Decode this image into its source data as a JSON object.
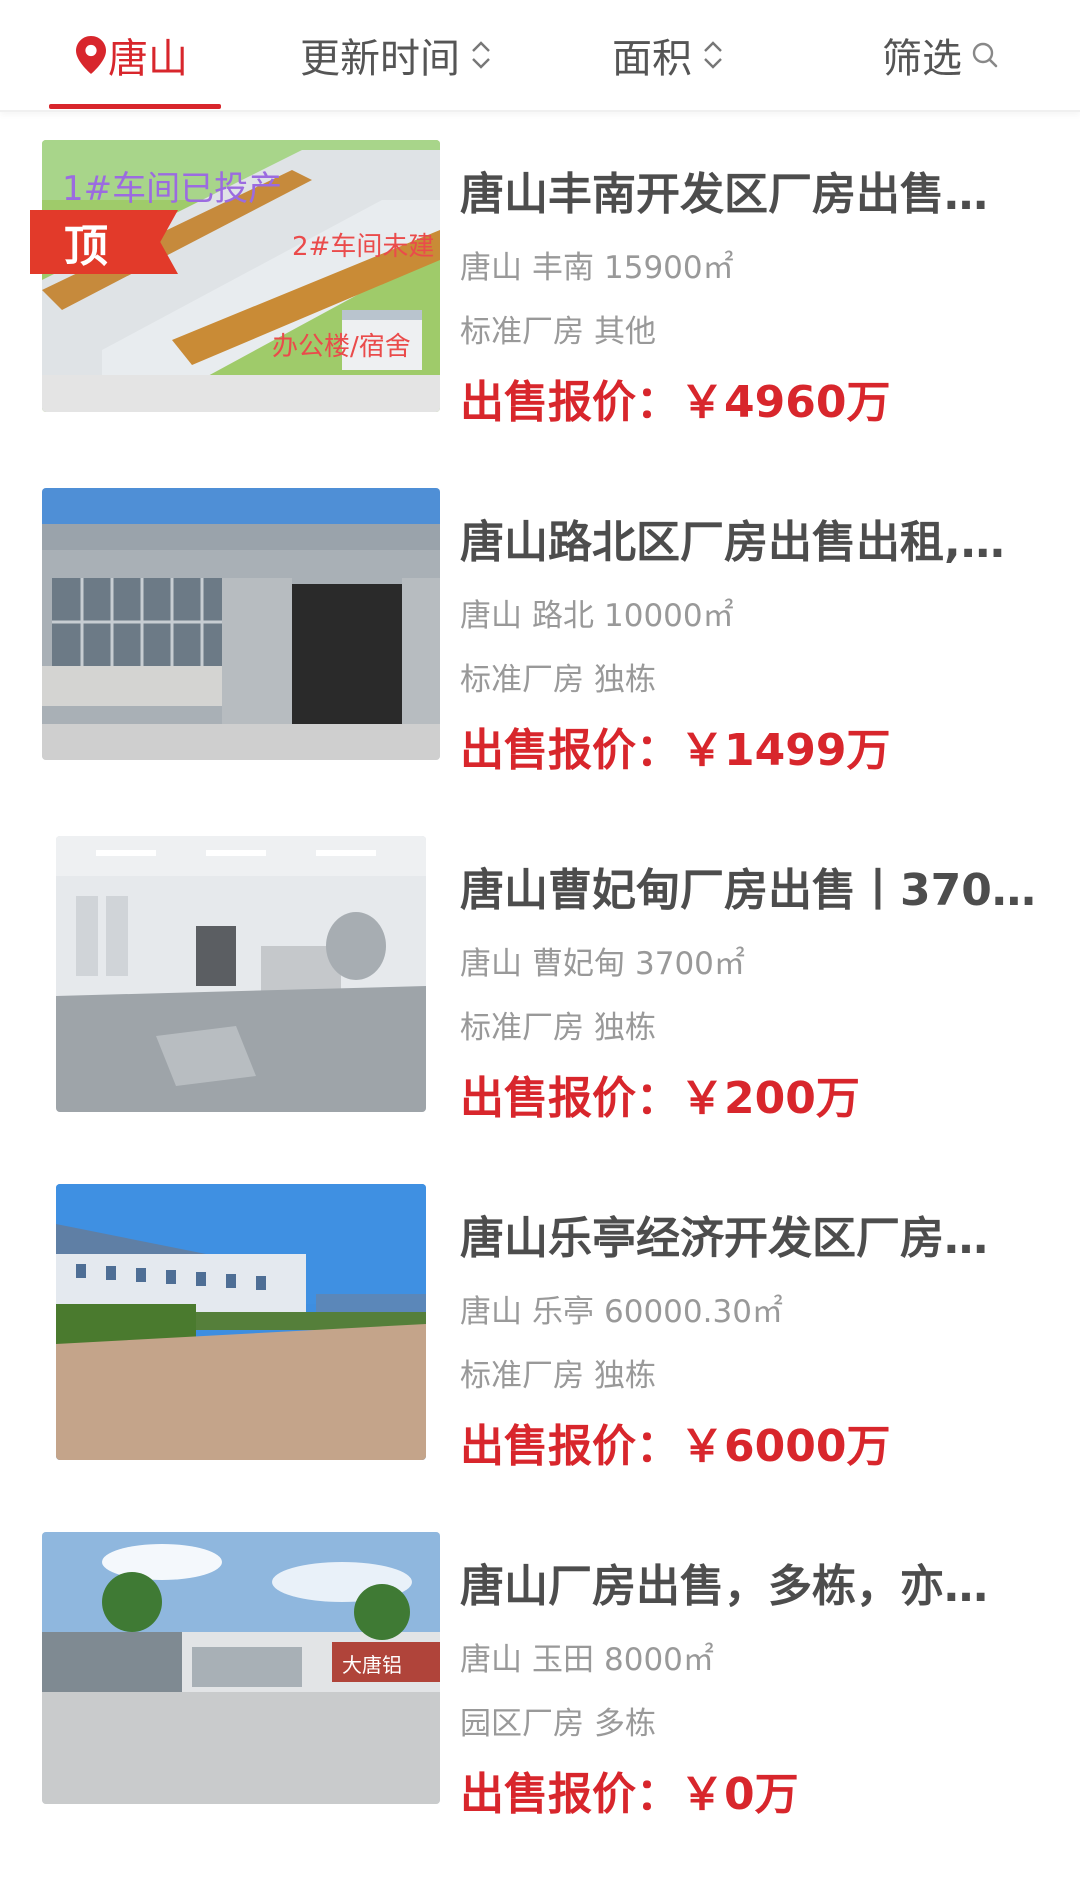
{
  "filter_bar": {
    "city_label": "唐山",
    "update_label": "更新时间",
    "area_label": "面积",
    "filter_label": "筛选",
    "accent_color": "#d8262c"
  },
  "listings": [
    {
      "title": "唐山丰南开发区厂房出售…",
      "city": "唐山",
      "district": "丰南",
      "area": "15900㎡",
      "type": "标准厂房",
      "structure": "其他",
      "price_label": "出售报价：",
      "price": "￥4960万",
      "badge": "顶",
      "image_text_1": "1#车间已投产",
      "image_text_2": "2#车间未建",
      "image_text_3": "办公楼/宿舍"
    },
    {
      "title": "唐山路北区厂房出售出租,…",
      "city": "唐山",
      "district": "路北",
      "area": "10000㎡",
      "type": "标准厂房",
      "structure": "独栋",
      "price_label": "出售报价：",
      "price": "￥1499万"
    },
    {
      "title": "唐山曹妃甸厂房出售丨370…",
      "city": "唐山",
      "district": "曹妃甸",
      "area": "3700㎡",
      "type": "标准厂房",
      "structure": "独栋",
      "price_label": "出售报价：",
      "price": "￥200万"
    },
    {
      "title": "唐山乐亭经济开发区厂房…",
      "city": "唐山",
      "district": "乐亭",
      "area": "60000.30㎡",
      "type": "标准厂房",
      "structure": "独栋",
      "price_label": "出售报价：",
      "price": "￥6000万"
    },
    {
      "title": "唐山厂房出售，多栋，亦…",
      "city": "唐山",
      "district": "玉田",
      "area": "8000㎡",
      "type": "园区厂房",
      "structure": "多栋",
      "price_label": "出售报价：",
      "price": "￥0万",
      "image_text_1": "大唐铝"
    }
  ]
}
